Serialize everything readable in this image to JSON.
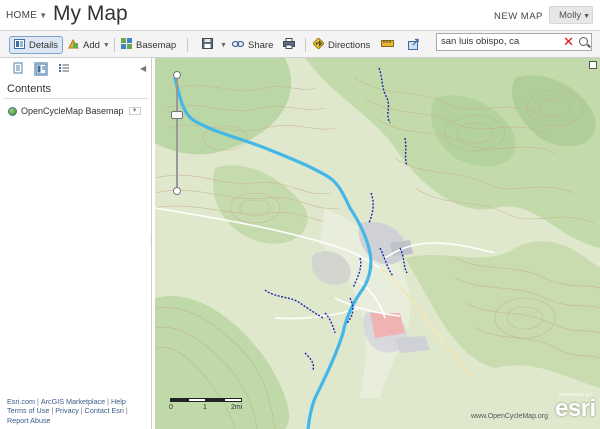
{
  "header": {
    "home_label": "HOME",
    "title": "My Map",
    "new_map_label": "NEW MAP",
    "user_label": "Molly"
  },
  "toolbar": {
    "details_label": "Details",
    "add_label": "Add",
    "basemap_label": "Basemap",
    "share_label": "Share",
    "directions_label": "Directions",
    "icons": [
      "details-icon",
      "add-icon",
      "basemap-icon",
      "save-icon",
      "share-icon",
      "print-icon",
      "directions-icon",
      "measure-icon",
      "bookmark-icon"
    ]
  },
  "search": {
    "value": "san luis obispo, ca",
    "clear_icon": "close-icon",
    "search_icon": "search-icon"
  },
  "panel": {
    "contents_heading": "Contents",
    "layers": [
      {
        "label": "OpenCycleMap Basemap",
        "icon": "globe-icon"
      }
    ],
    "footer_links": [
      "Esri.com",
      "ArcGIS Marketplace",
      "Help",
      "Terms of Use",
      "Privacy",
      "Contact Esri",
      "Report Abuse"
    ]
  },
  "map": {
    "scale_labels": [
      "0",
      "1",
      "2mi"
    ],
    "attribution": "www.OpenCycleMap.org",
    "powered_by": "POWERED BY",
    "brand": "esri",
    "colors": {
      "land": "#dfe8cc",
      "forest": "#b9d5a4",
      "contour": "#c9a988",
      "cycle_route": "#43b7e8",
      "trail": "#1a2ab0",
      "urban": "#cfd1d6",
      "campus": "#f0b3b3"
    }
  }
}
